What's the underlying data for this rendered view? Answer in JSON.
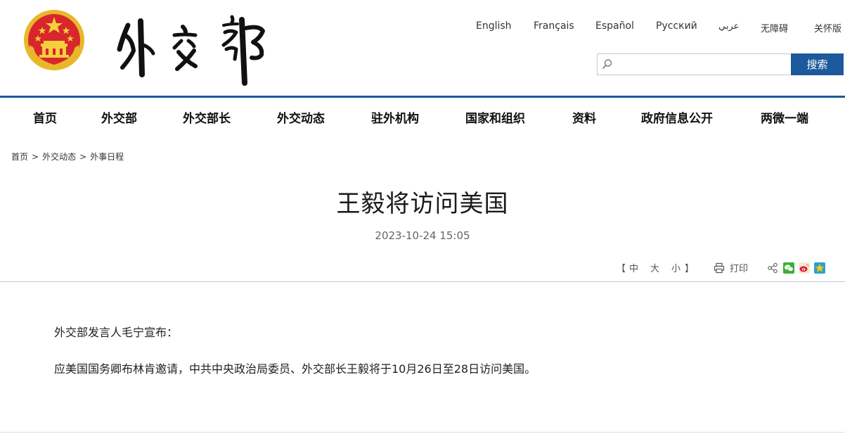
{
  "header": {
    "languages": [
      "English",
      "Français",
      "Español",
      "Русский",
      "عربي",
      "无障碍",
      "关怀版"
    ],
    "search": {
      "placeholder": "",
      "button_label": "搜索"
    }
  },
  "nav": {
    "items": [
      "首页",
      "外交部",
      "外交部长",
      "外交动态",
      "驻外机构",
      "国家和组织",
      "资料",
      "政府信息公开",
      "两微一端"
    ]
  },
  "breadcrumb": {
    "items": [
      "首页",
      "外交动态",
      "外事日程"
    ],
    "separator": ">"
  },
  "article": {
    "title": "王毅将访问美国",
    "date": "2023-10-24 15:05",
    "font_size": {
      "bracket_open": "【",
      "large": "中",
      "medium": "大",
      "small": "小",
      "bracket_close": "】"
    },
    "print_label": "打印",
    "paragraphs": [
      "外交部发言人毛宁宣布：",
      "应美国国务卿布林肯邀请，中共中央政治局委员、外交部长王毅将于10月26日至28日访问美国。"
    ]
  },
  "icons": {
    "emblem": "national-emblem-icon",
    "calligraphy": "ministry-calligraphy-logo",
    "search": "search-icon",
    "print": "printer-icon",
    "share": "share-icon",
    "wechat": "wechat-icon",
    "weibo": "weibo-icon",
    "qzone": "qzone-icon"
  },
  "colors": {
    "primary": "#1c5a9b",
    "divider": "#b8ccd8"
  }
}
